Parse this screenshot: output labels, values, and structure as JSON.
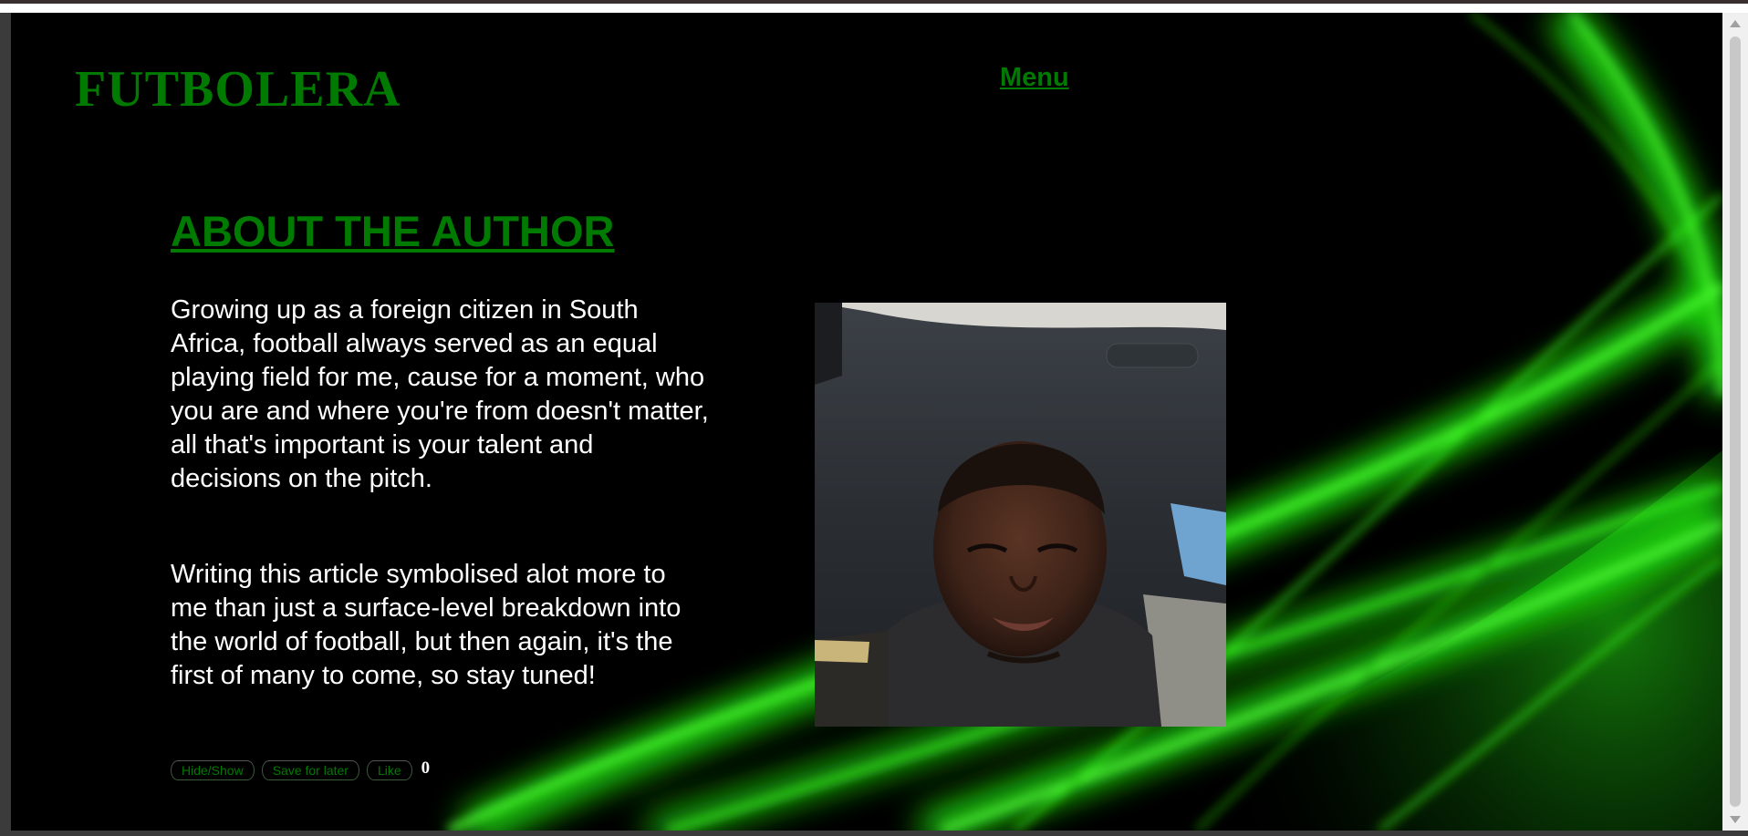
{
  "site": {
    "brand": "FUTBOLERA",
    "menu_label": "Menu"
  },
  "about": {
    "title": "ABOUT THE AUTHOR",
    "paragraphs": [
      "Growing up as a foreign citizen in South Africa, football always served as an equal playing field for me, cause for a moment, who you are and where you're from doesn't matter, all that's important is your talent and decisions on the pitch.",
      "Writing this article symbolised alot more to me than just a surface-level breakdown into the world of football, but then again, it's the first of many to come, so stay tuned!"
    ]
  },
  "actions": {
    "hide_show_label": "Hide/Show",
    "save_label": "Save for later",
    "like_label": "Like",
    "like_count": "0"
  },
  "colors": {
    "brand_green": "#007a00",
    "neon_green": "#39ff14",
    "background": "#000000",
    "text": "#ffffff"
  },
  "images": {
    "author_photo": "author-selfie-in-car",
    "background": "neon-green-light-streaks"
  }
}
